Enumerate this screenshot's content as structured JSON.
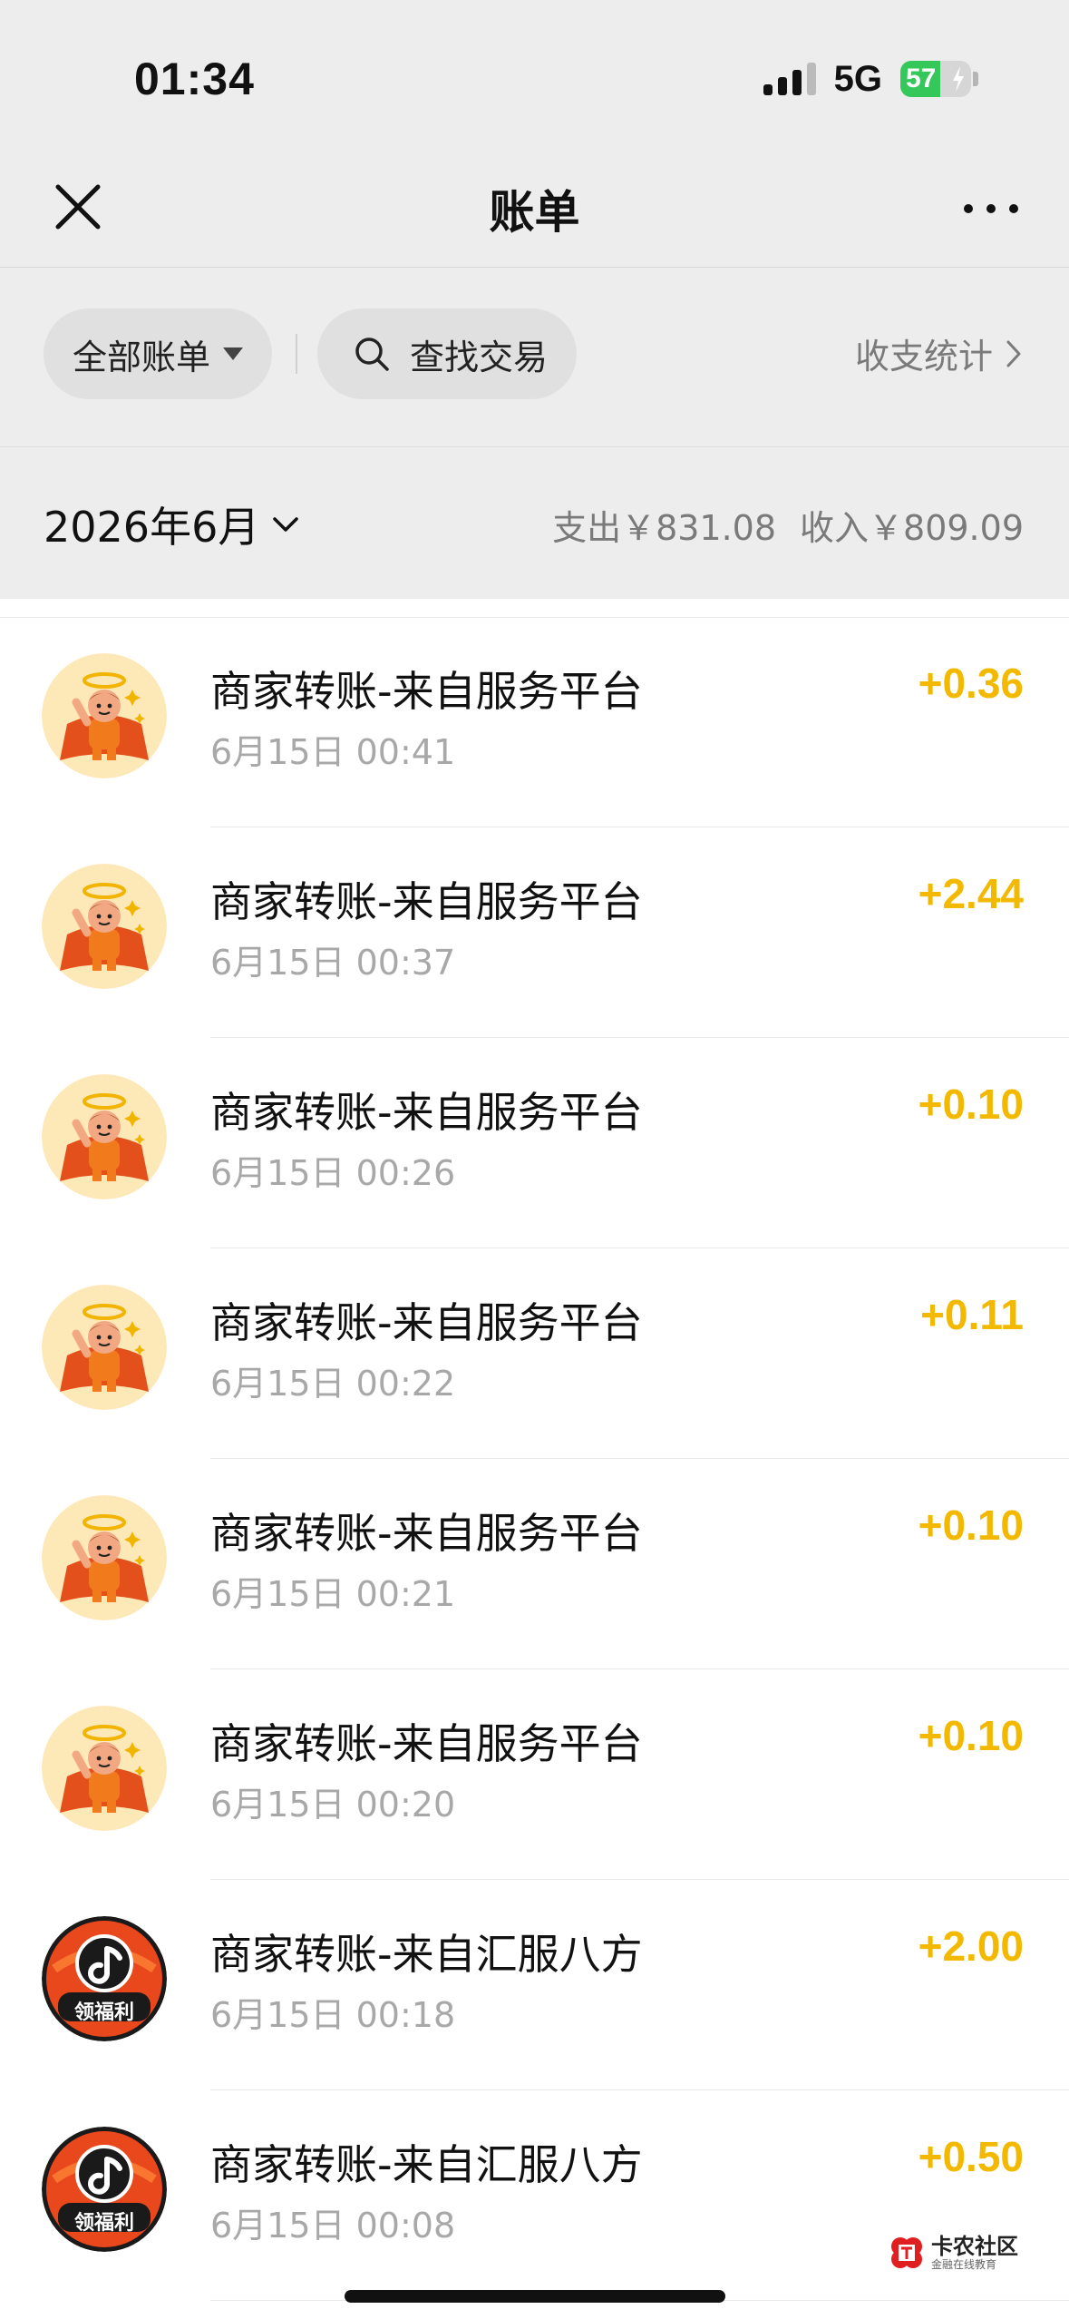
{
  "status": {
    "time": "01:34",
    "network": "5G",
    "battery": "57"
  },
  "nav": {
    "title": "账单"
  },
  "filter": {
    "all_label": "全部账单",
    "search_label": "查找交易",
    "stats_label": "收支统计"
  },
  "month": {
    "label": "2026年6月",
    "expense": "支出￥831.08",
    "income": "收入￥809.09"
  },
  "avatars": {
    "hero": {
      "icon": "hero-mascot-icon",
      "bg": "#fde9b7"
    },
    "fuli": {
      "icon": "music-note-badge-icon",
      "text": "领福利",
      "bg": "#e9471c"
    }
  },
  "transactions": [
    {
      "title": "商家转账-来自服务平台",
      "time": "6月15日 00:41",
      "amount": "+0.36",
      "avatar": "hero"
    },
    {
      "title": "商家转账-来自服务平台",
      "time": "6月15日 00:37",
      "amount": "+2.44",
      "avatar": "hero"
    },
    {
      "title": "商家转账-来自服务平台",
      "time": "6月15日 00:26",
      "amount": "+0.10",
      "avatar": "hero"
    },
    {
      "title": "商家转账-来自服务平台",
      "time": "6月15日 00:22",
      "amount": "+0.11",
      "avatar": "hero"
    },
    {
      "title": "商家转账-来自服务平台",
      "time": "6月15日 00:21",
      "amount": "+0.10",
      "avatar": "hero"
    },
    {
      "title": "商家转账-来自服务平台",
      "time": "6月15日 00:20",
      "amount": "+0.10",
      "avatar": "hero"
    },
    {
      "title": "商家转账-来自汇服八方",
      "time": "6月15日 00:18",
      "amount": "+2.00",
      "avatar": "fuli"
    },
    {
      "title": "商家转账-来自汇服八方",
      "time": "6月15日 00:08",
      "amount": "+0.50",
      "avatar": "fuli"
    }
  ],
  "watermark": {
    "title": "卡农社区",
    "subtitle": "金融在线教育"
  }
}
